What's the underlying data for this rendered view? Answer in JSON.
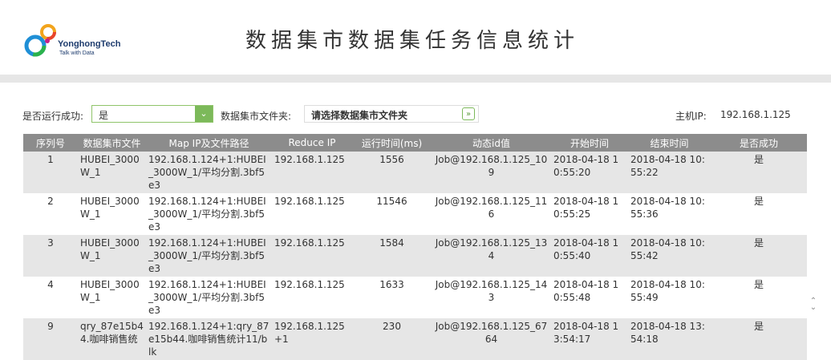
{
  "header": {
    "brand_name": "YonghongTech",
    "brand_tagline": "Talk with Data",
    "title": "数据集市数据集任务信息统计"
  },
  "filters": {
    "success_label": "是否运行成功:",
    "success_value": "是",
    "folder_label": "数据集市文件夹:",
    "folder_value": "请选择数据集市文件夹",
    "host_label": "主机IP:",
    "host_value": "192.168.1.125"
  },
  "table": {
    "columns": [
      "序列号",
      "数据集市文件",
      "Map IP及文件路径",
      "Reduce IP",
      "运行时间(ms)",
      "动态id值",
      "开始时间",
      "结束时间",
      "是否成功"
    ],
    "rows": [
      [
        "1",
        "HUBEI_3000W_1",
        "192.168.1.124+1:HUBEI_3000W_1/平均分割.3bf5e3",
        "192.168.1.125",
        "1556",
        "Job@192.168.1.125_109",
        "2018-04-18 10:55:20",
        "2018-04-18 10:55:22",
        "是"
      ],
      [
        "2",
        "HUBEI_3000W_1",
        "192.168.1.124+1:HUBEI_3000W_1/平均分割.3bf5e3",
        "192.168.1.125",
        "11546",
        "Job@192.168.1.125_116",
        "2018-04-18 10:55:25",
        "2018-04-18 10:55:36",
        "是"
      ],
      [
        "3",
        "HUBEI_3000W_1",
        "192.168.1.124+1:HUBEI_3000W_1/平均分割.3bf5e3",
        "192.168.1.125",
        "1584",
        "Job@192.168.1.125_134",
        "2018-04-18 10:55:40",
        "2018-04-18 10:55:42",
        "是"
      ],
      [
        "4",
        "HUBEI_3000W_1",
        "192.168.1.124+1:HUBEI_3000W_1/平均分割.3bf5e3",
        "192.168.1.125",
        "1633",
        "Job@192.168.1.125_143",
        "2018-04-18 10:55:48",
        "2018-04-18 10:55:49",
        "是"
      ],
      [
        "9",
        "qry_87e15b44.咖啡销售统",
        "192.168.1.124+1:qry_87e15b44.咖啡销售统计11/blk",
        "192.168.1.125+1",
        "230",
        "Job@192.168.1.125_6764",
        "2018-04-18 13:54:17",
        "2018-04-18 13:54:18",
        "是"
      ]
    ]
  },
  "icons": {
    "select_arrow": "chevron-down-icon",
    "folder_arrow": "double-chevron-down-icon",
    "scroll": "scroll-updown-icon"
  },
  "colors": {
    "accent_green": "#7cb95a",
    "header_gray": "#8c8c8c",
    "row_stripe": "#e6e6e6"
  }
}
